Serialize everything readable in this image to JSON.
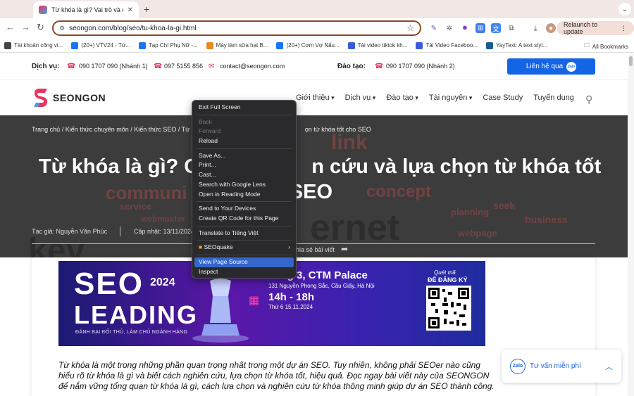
{
  "browser": {
    "tab_title": "Từ khóa là gì? Vai trò và cách",
    "new_tab": "+",
    "url": "seongon.com/blog/seo/tu-khoa-la-gi.html",
    "relaunch_label": "Relaunch to update",
    "bookmarks": [
      {
        "label": "Tài khoản công vi...",
        "color": "#444"
      },
      {
        "label": "(20+) VTV24 - Tứ...",
        "color": "#1877f2"
      },
      {
        "label": "Tạp Chí Phụ Nữ -...",
        "color": "#1877f2"
      },
      {
        "label": "Máy làm sữa hạt B...",
        "color": "#e88a20"
      },
      {
        "label": "(20+) Cơm Vợ Nấu...",
        "color": "#1877f2"
      },
      {
        "label": "Tải video tiktok kh...",
        "color": "#3b5bdb"
      },
      {
        "label": "Tải Video Faceboo...",
        "color": "#3b5bdb"
      },
      {
        "label": "YayText: A text styl...",
        "color": "#1c5b8f"
      }
    ],
    "all_bookmarks": "All Bookmarks"
  },
  "contact": {
    "service_label": "Dịch vụ:",
    "phone1": "090 1707 090 (Nhánh 1)",
    "phone2": "097 5155 856",
    "email": "contact@seongon.com",
    "training_label": "Đào tạo:",
    "phone3": "090 1707 090 (Nhánh 2)",
    "cta": "Liên hệ qua",
    "zalo": "Zalo"
  },
  "nav": {
    "logo": "SEONGON",
    "items": [
      "Giới thiệu",
      "Dịch vụ",
      "Đào tạo",
      "Tài nguyên",
      "Case Study",
      "Tuyển dụng"
    ]
  },
  "hero": {
    "breadcrumb": "Trang chủ / Kiến thức chuyên môn / Kiến thức SEO / Từ k",
    "breadcrumb_tail": "ọn từ khóa tốt cho SEO",
    "title_left": "Từ khóa là gì? C",
    "title_right": "n cứu và lựa chọn từ khóa tốt",
    "title_line2": "o SEO",
    "author": "Tác giả: Nguyễn Văn Phúc",
    "date": "Cập nhật: 13/11/2024",
    "share": "hia sẻ bài viết"
  },
  "banner": {
    "seo": "SEO",
    "year": "2024",
    "leading": "LEADING",
    "tagline": "ĐÁNH BẠI ĐỐI THỦ, LÀM CHỦ NGÀNH HÀNG",
    "venue": "Tầng 3, CTM Palace",
    "address": "131 Nguyễn Phong Sắc, Cầu Giấy, Hà Nội",
    "time": "14h - 18h",
    "day": "Thứ 6 15.11.2024",
    "scan": "Quét mã",
    "register": "ĐỂ ĐĂNG KÝ"
  },
  "intro": "Từ khóa là một trong những phần quan trọng nhất trong một dự án SEO. Tuy nhiên, không phải SEOer nào cũng hiểu rõ từ khóa là gì và biết cách nghiên cứu, lựa chọn từ khóa tốt, hiệu quả. Đọc ngay bài viết này của SEONGON để nắm vững tổng quan từ khóa là gì, cách lựa chọn và nghiên cứu từ khóa thông minh giúp dự án SEO thành công.",
  "chat": {
    "label": "Tư vấn miễn phí",
    "zalo": "Zalo"
  },
  "context_menu": {
    "items": [
      {
        "label": "Exit Full Screen"
      },
      {
        "sep": true
      },
      {
        "label": "Back",
        "disabled": true
      },
      {
        "label": "Forward",
        "disabled": true
      },
      {
        "label": "Reload"
      },
      {
        "sep": true
      },
      {
        "label": "Save As..."
      },
      {
        "label": "Print..."
      },
      {
        "label": "Cast..."
      },
      {
        "label": "Search with Google Lens"
      },
      {
        "label": "Open in Reading Mode"
      },
      {
        "sep": true
      },
      {
        "label": "Send to Your Devices"
      },
      {
        "label": "Create QR Code for this Page"
      },
      {
        "sep": true
      },
      {
        "label": "Translate to Tiếng Việt"
      },
      {
        "sep": true
      },
      {
        "label": "SEOquake",
        "submenu": true
      },
      {
        "sep": true
      },
      {
        "label": "View Page Source",
        "selected": true
      },
      {
        "label": "Inspect"
      }
    ]
  },
  "colors": {
    "brand_blue": "#1464e6",
    "brand_red": "#e7355d",
    "hero_bg": "#3c3c3c"
  }
}
